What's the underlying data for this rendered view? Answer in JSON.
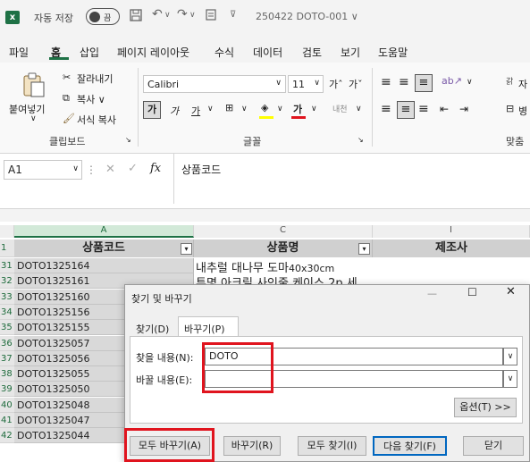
{
  "titlebar": {
    "autosave_label": "자동 저장",
    "toggle_text": "끔",
    "filename": "250422 DOTO-001 ∨"
  },
  "menu": [
    "파일",
    "홈",
    "삽입",
    "페이지 레이아웃",
    "수식",
    "데이터",
    "검토",
    "보기",
    "도움말"
  ],
  "ribbon": {
    "clipboard": {
      "paste": "붙여넣기",
      "cut": "잘라내기",
      "copy": "복사 ∨",
      "format_painter": "서식 복사",
      "label": "클립보드"
    },
    "font": {
      "name": "Calibri",
      "size": "11",
      "label": "글꼴"
    },
    "align": {
      "label": "맞춤",
      "wrap_short": "자",
      "merge_short": "병"
    }
  },
  "formula": {
    "namebox": "A1",
    "fx": "fx",
    "content": "상품코드"
  },
  "sheet": {
    "columns": [
      "A",
      "C",
      "I"
    ],
    "header_row_num": "1",
    "headers": [
      "상품코드",
      "상품명",
      "제조사"
    ],
    "rows": [
      {
        "num": "31",
        "code": "DOTO1325164"
      },
      {
        "num": "32",
        "code": "DOTO1325161"
      },
      {
        "num": "33",
        "code": "DOTO1325160"
      },
      {
        "num": "34",
        "code": "DOTO1325156"
      },
      {
        "num": "35",
        "code": "DOTO1325155"
      },
      {
        "num": "36",
        "code": "DOTO1325057"
      },
      {
        "num": "37",
        "code": "DOTO1325056"
      },
      {
        "num": "38",
        "code": "DOTO1325055"
      },
      {
        "num": "39",
        "code": "DOTO1325050"
      },
      {
        "num": "40",
        "code": "DOTO1325048"
      },
      {
        "num": "41",
        "code": "DOTO1325047"
      },
      {
        "num": "42",
        "code": "DOTO1325044"
      }
    ],
    "c31": "내추럴 대나무 도마",
    "c31_size": "40x30cm",
    "c32_partial": "투명 아크릴 사인줄 케이스 2p 세"
  },
  "dialog": {
    "title": "찾기 및 바꾸기",
    "tab_find": "찾기(D)",
    "tab_replace": "바꾸기(P)",
    "find_label": "찾을 내용(N):",
    "find_value": "DOTO",
    "replace_label": "바꿀 내용(E):",
    "replace_value": "",
    "options_btn": "옵션(T) >>",
    "replace_all": "모두 바꾸기(A)",
    "replace": "바꾸기(R)",
    "find_all": "모두 찾기(I)",
    "find_next": "다음 찾기(F)",
    "close": "닫기"
  },
  "colors": {
    "excel_green": "#1e7145",
    "highlight_red": "#e0141e"
  }
}
